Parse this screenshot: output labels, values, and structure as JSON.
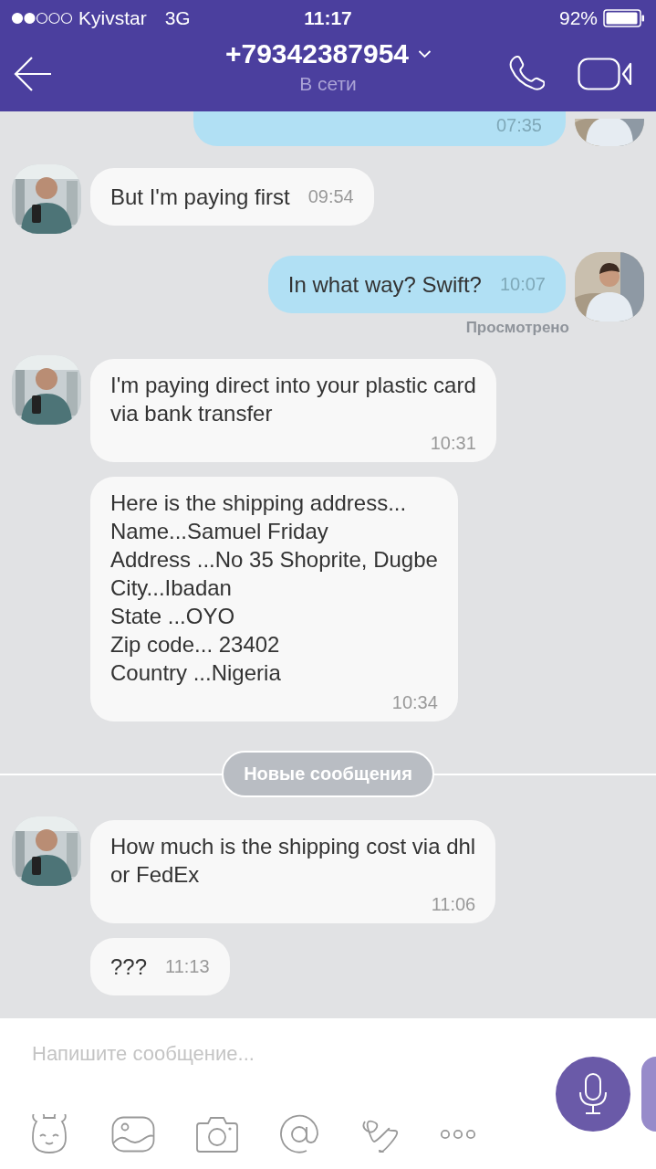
{
  "status_bar": {
    "carrier": "Kyivstar",
    "network": "3G",
    "time": "11:17",
    "battery": "92%"
  },
  "header": {
    "title": "+79342387954",
    "subtitle": "В сети"
  },
  "messages": [
    {
      "kind": "outgoing",
      "cut": true,
      "avatar": true,
      "time_below": true,
      "time": "07:35"
    },
    {
      "kind": "incoming",
      "cut": false,
      "avatar": true,
      "time_below": false,
      "text": "But I'm paying first",
      "time": "09:54"
    },
    {
      "kind": "outgoing",
      "cut": false,
      "avatar": true,
      "time_below": false,
      "text": "In what way? Swift?",
      "time": "10:07",
      "status": "Просмотрено"
    },
    {
      "kind": "incoming",
      "cut": false,
      "avatar": true,
      "time_below": true,
      "text": "I'm paying direct into your plastic card\nvia bank transfer",
      "time": "10:31"
    },
    {
      "kind": "incoming",
      "cut": false,
      "avatar": false,
      "time_below": true,
      "text": "Here is the shipping address...\nName...Samuel Friday\nAddress ...No 35 Shoprite, Dugbe\nCity...Ibadan\nState ...OYO\nZip code... 23402\nCountry ...Nigeria",
      "time": "10:34"
    },
    {
      "kind": "divider",
      "label": "Новые сообщения"
    },
    {
      "kind": "incoming",
      "cut": false,
      "avatar": true,
      "time_below": true,
      "text": "How much is the shipping cost via dhl\nor FedEx",
      "time": "11:06"
    },
    {
      "kind": "incoming",
      "cut": false,
      "avatar": false,
      "time_below": false,
      "text": "???",
      "time": "11:13"
    }
  ],
  "composer": {
    "placeholder": "Напишите сообщение..."
  }
}
